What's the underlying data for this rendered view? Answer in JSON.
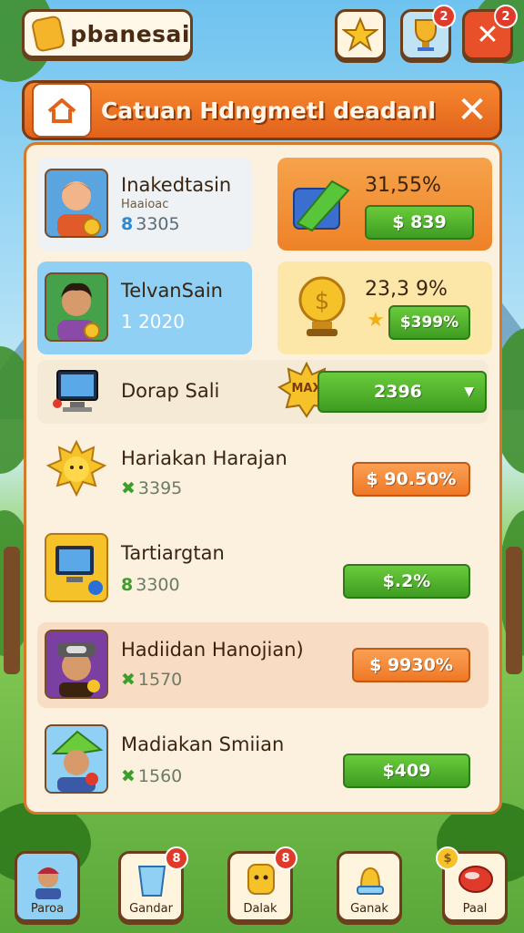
{
  "top": {
    "player_name": "pbanesai",
    "badges": [
      "2",
      "2"
    ]
  },
  "banner": {
    "title": "Catuan Hdngmetl deadanl",
    "close": "✕"
  },
  "cards": [
    {
      "name": "Inakedtasin",
      "sub": "Haaioac",
      "amount": "3305",
      "amount_icon": "8",
      "pct": "31,55%",
      "reward": "$ 839"
    },
    {
      "name": "TelvanSain",
      "amount": "1 2020",
      "pct": "23,3 9%",
      "reward": "$399%"
    }
  ],
  "promo_row": {
    "name": "Dorap Sali",
    "badge": "MAX",
    "reward": "2396"
  },
  "list": [
    {
      "name": "Hariakan Harajan",
      "amount": "3395",
      "amount_icon": "✖",
      "reward": "$ 90.50%"
    },
    {
      "name": "Tartiargtan",
      "amount": "3300",
      "amount_icon": "8",
      "reward": "$.2%"
    },
    {
      "name": "Hadiidan Hanojian)",
      "amount": "1570",
      "amount_icon": "✖",
      "reward": "$ 9930%"
    },
    {
      "name": "Madiakan Smiian",
      "amount": "1560",
      "amount_icon": "✖",
      "reward": "$409"
    }
  ],
  "dock": [
    {
      "label": "Paroa"
    },
    {
      "label": "Gandar",
      "badge": "8"
    },
    {
      "label": "Dalak",
      "badge": "8"
    },
    {
      "label": "Ganak"
    },
    {
      "label": "Paal",
      "badge": "$"
    }
  ]
}
